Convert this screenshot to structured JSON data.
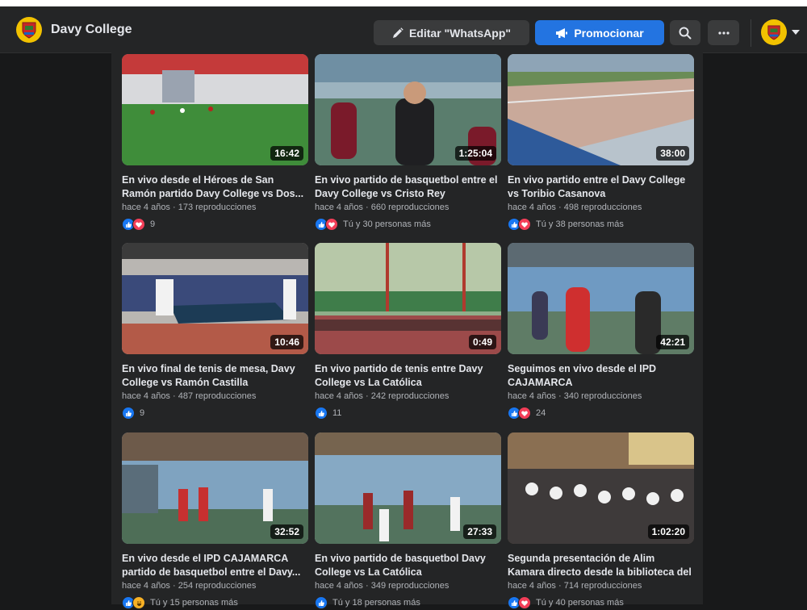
{
  "header": {
    "page_name": "Davy College",
    "edit_button": "Editar \"WhatsApp\"",
    "promote_button": "Promocionar",
    "icons": [
      "pencil-icon",
      "megaphone-icon",
      "search-icon",
      "more-icon",
      "chevron-down-icon"
    ]
  },
  "videos": [
    {
      "title": "En vivo desde el Héroes de San Ramón partido Davy College vs Dos...",
      "age": "hace 4 años",
      "views": "173 reproducciones",
      "duration": "16:42",
      "reactions": [
        "like",
        "love"
      ],
      "reaction_text": "9"
    },
    {
      "title": "En vivo partido de basquetbol entre el Davy College vs Cristo Rey",
      "age": "hace 4 años",
      "views": "660 reproducciones",
      "duration": "1:25:04",
      "reactions": [
        "like",
        "love"
      ],
      "reaction_text": "Tú y 30 personas más"
    },
    {
      "title": "En vivo partido entre el Davy College vs Toribio Casanova",
      "age": "hace 4 años",
      "views": "498 reproducciones",
      "duration": "38:00",
      "reactions": [
        "like",
        "love"
      ],
      "reaction_text": "Tú y 38 personas más"
    },
    {
      "title": "En vivo final de tenis de mesa, Davy College vs Ramón Castilla",
      "age": "hace 4 años",
      "views": "487 reproducciones",
      "duration": "10:46",
      "reactions": [
        "like"
      ],
      "reaction_text": "9"
    },
    {
      "title": "En vivo partido de tenis entre Davy College vs La Católica",
      "age": "hace 4 años",
      "views": "242 reproducciones",
      "duration": "0:49",
      "reactions": [
        "like"
      ],
      "reaction_text": "11"
    },
    {
      "title": "Seguimos en vivo desde el IPD CAJAMARCA",
      "age": "hace 4 años",
      "views": "340 reproducciones",
      "duration": "42:21",
      "reactions": [
        "like",
        "love"
      ],
      "reaction_text": "24"
    },
    {
      "title": "En vivo desde el IPD CAJAMARCA partido de basquetbol entre el Davy...",
      "age": "hace 4 años",
      "views": "254 reproducciones",
      "duration": "32:52",
      "reactions": [
        "like",
        "haha"
      ],
      "reaction_text": "Tú y 15 personas más"
    },
    {
      "title": "En vivo partido de basquetbol Davy College vs La Católica",
      "age": "hace 4 años",
      "views": "349 reproducciones",
      "duration": "27:33",
      "reactions": [
        "like"
      ],
      "reaction_text": "Tú y 18 personas más"
    },
    {
      "title": "Segunda presentación de Alim Kamara directo desde la biblioteca del Davy...",
      "age": "hace 4 años",
      "views": "714 reproducciones",
      "duration": "1:02:20",
      "reactions": [
        "like",
        "love"
      ],
      "reaction_text": "Tú y 40 personas más"
    }
  ],
  "meta_separator": " · ",
  "colors": {
    "accent": "#2374e1",
    "background": "#18191a",
    "surface": "#242526"
  }
}
